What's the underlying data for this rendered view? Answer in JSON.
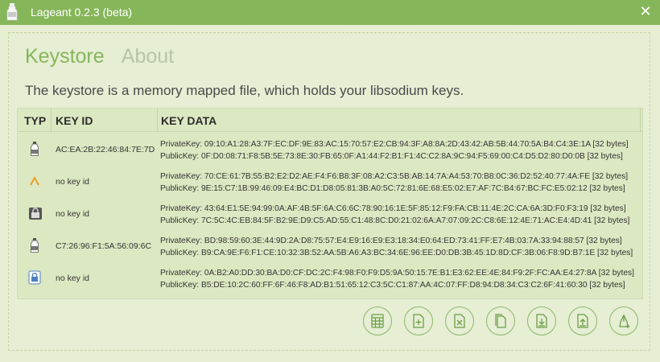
{
  "window": {
    "title": "Lageant 0.2.3 (beta)",
    "close_symbol": "✕"
  },
  "tabs": [
    {
      "label": "Keystore",
      "active": true
    },
    {
      "label": "About",
      "active": false
    }
  ],
  "description": "The keystore is a memory mapped file, which holds your libsodium keys.",
  "table": {
    "headers": {
      "type": "TYP",
      "key_id": "KEY ID",
      "key_data": "KEY DATA"
    },
    "rows": [
      {
        "icon": "bottle-icon",
        "key_id": "AC:EA:2B:22:46:84:7E:7D",
        "private": "PrivateKey: 09:10:A1:28:A3:7F:EC:DF:9E:83:AC:15:70:57:E2:CB:94:3F:A8:8A:2D:43:42:AB:5B:44:70:5A:B4:C4:3E:1A [32 bytes]",
        "public": "PublicKey: 0F:D0:08:71:F8:5B:5E:73:8E:30:FB:65:0F:A1:44:F2:B1:F1:4C:C2:8A:9C:94:F5:69:00:C4:D5:D2:80:D0:0B [32 bytes]"
      },
      {
        "icon": "caret-icon",
        "key_id": "no key id",
        "private": "PrivateKey: 70:CE:61:7B:55:B2:E2:D2:AE:F4:F6:B8:3F:08:A2:C3:5B:AB:14:7A:A4:53:70:B8:0C:36:D2:52:40:77:4A:FE [32 bytes]",
        "public": "PublicKey: 9E:15:C7:1B:99:46:09:E4:BC:D1:D8:05:81:3B:A0:5C:72:81:6E:68:E5:02:E7:AF:7C:B4:67:BC:FC:E5:02:12 [32 bytes]"
      },
      {
        "icon": "lock-box-icon",
        "key_id": "no key id",
        "private": "PrivateKey: 43:64:E1:5E:94:99:0A:AF:4B:5F:6A:C6:6C:78:90:16:1E:5F:85:12:F9:FA:CB:11:4E:2C:CA:6A:3D:F0:F3:19 [32 bytes]",
        "public": "PublicKey: 7C:5C:4C:EB:84:5F:B2:9E:D9:C5:AD:55:C1:48:8C:D0:21:02:6A:A7:07:09:2C:C8:6E:12:4E:71:AC:E4:4D:41 [32 bytes]"
      },
      {
        "icon": "bottle-icon",
        "key_id": "C7:26:96:F1:5A:56:09:6C",
        "private": "PrivateKey: BD:98:59:60:3E:44:9D:2A:D8:75:57:E4:E9:16:E9:E3:18:34:E0:64:ED:73:41:FF:E7:4B:03:7A:33:94:88:57 [32 bytes]",
        "public": "PublicKey: B9:CA:9E:F6:F1:CE:10:32:3B:52:AA:5B:A6:A3:BC:34:6E:96:EE:D0:DB:3B:45:1D:8D:CF:3B:06:F8:9D:B7:1E [32 bytes]"
      },
      {
        "icon": "padlock-icon",
        "key_id": "no key id",
        "private": "PrivateKey: 0A:B2:A0:DD:30:BA:D0:CF:DC:2C:F4:98:F0:F9:D5:9A:50:15:7E:B1:E3:62:EE:4E:84:F9:2F:FC:AA:E4:27:8A [32 bytes]",
        "public": "PublicKey: B5:DE:10:2C:60:FF:6F:46:F8:AD:B1:51:65:12:C3:5C:C1:87:AA:4C:07:FF:D8:94:D8:34:C3:C2:6F:41:60:30 [32 bytes]"
      }
    ]
  },
  "actions": [
    {
      "name": "calculator-button",
      "icon": "calculator-icon"
    },
    {
      "name": "add-key-button",
      "icon": "document-plus-icon"
    },
    {
      "name": "delete-key-button",
      "icon": "document-x-icon"
    },
    {
      "name": "copy-button",
      "icon": "copy-icon"
    },
    {
      "name": "import-button",
      "icon": "download-icon"
    },
    {
      "name": "export-button",
      "icon": "upload-icon"
    },
    {
      "name": "add-signature-button",
      "icon": "pen-plus-icon"
    }
  ],
  "colors": {
    "accent": "#86b65a",
    "background": "#e6eed4",
    "table_bg": "#dce8c2"
  }
}
